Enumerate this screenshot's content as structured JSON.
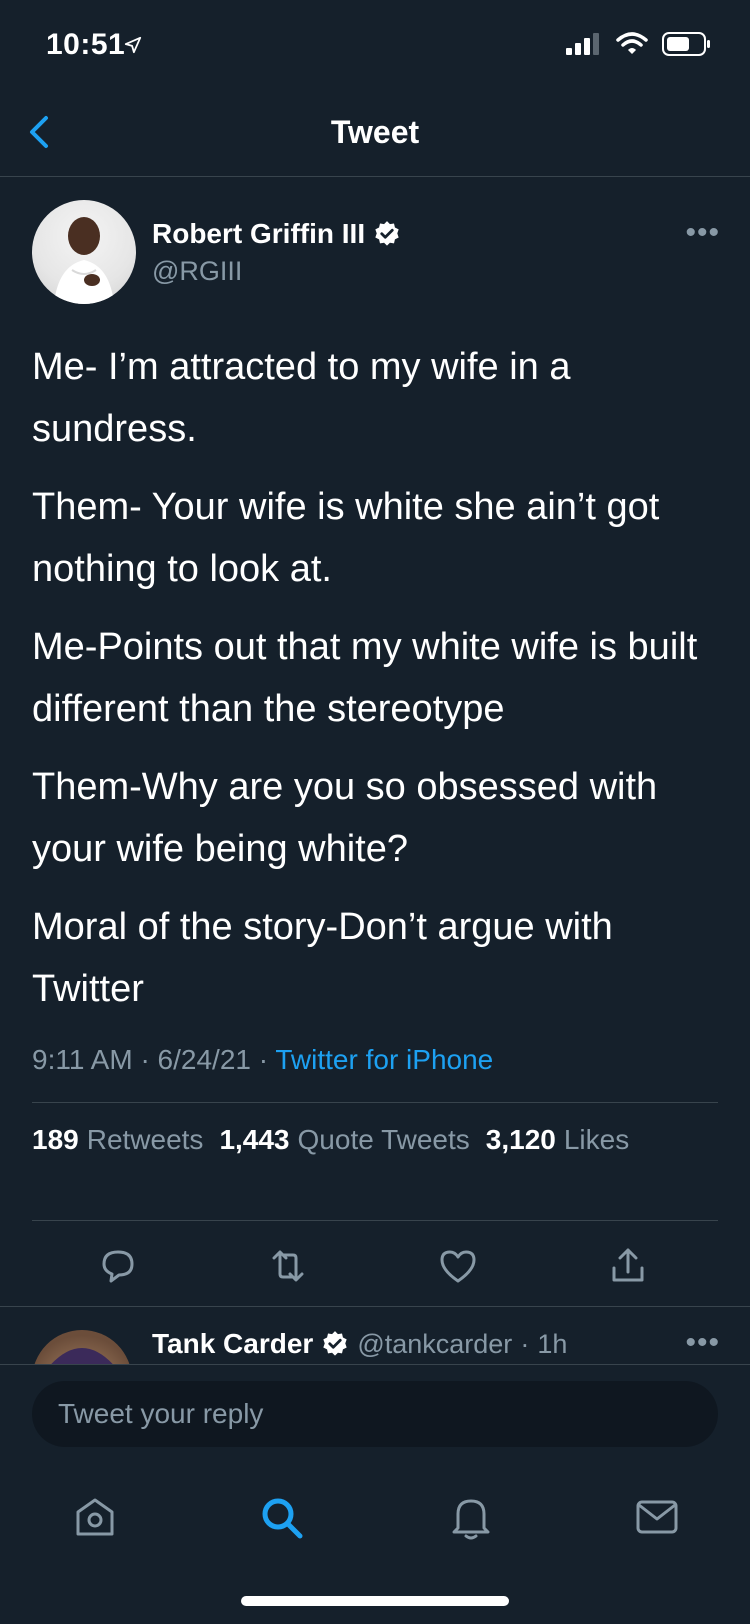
{
  "status_bar": {
    "time": "10:51"
  },
  "nav": {
    "title": "Tweet"
  },
  "tweet": {
    "author_name": "Robert Griffin III",
    "author_handle": "@RGIII",
    "paragraphs": [
      "Me- I’m attracted to my wife in a sundress.",
      "Them- Your wife is white she ain’t got nothing to look at.",
      "Me-Points out that my white wife is built different than the stereotype",
      "Them-Why are you so obsessed with your wife being white?",
      "Moral of the story-Don’t argue with Twitter"
    ],
    "time": "9:11 AM",
    "date": "6/24/21",
    "source": "Twitter for iPhone",
    "stats": {
      "retweets_count": "189",
      "retweets_label": "Retweets",
      "quotes_count": "1,443",
      "quotes_label": "Quote Tweets",
      "likes_count": "3,120",
      "likes_label": "Likes"
    }
  },
  "reply_preview": {
    "name": "Tank Carder",
    "handle": "@tankcarder",
    "time": "1h"
  },
  "composer": {
    "placeholder": "Tweet your reply"
  },
  "colors": {
    "background": "#15202b",
    "accent": "#1da1f2",
    "secondary_text": "#8899a6",
    "divider": "#38444d"
  }
}
